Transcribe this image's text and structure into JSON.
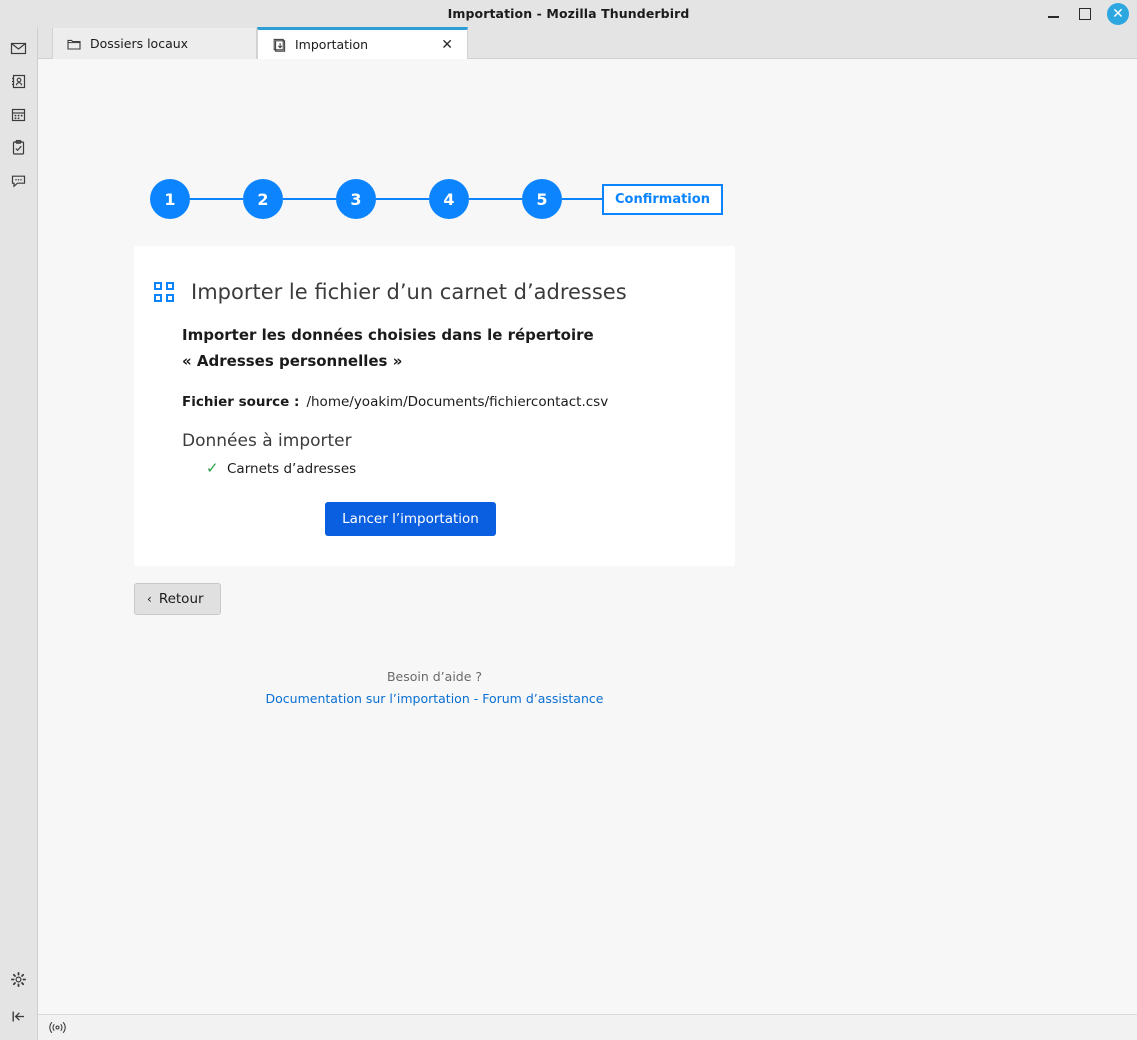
{
  "window": {
    "title": "Importation - Mozilla Thunderbird",
    "controls": {
      "minimize": "minimize-icon",
      "maximize": "maximize-icon",
      "close": "✕"
    }
  },
  "spaces_bar": {
    "items": [
      {
        "name": "mail-icon",
        "label": "Courrier"
      },
      {
        "name": "address-book-icon",
        "label": "Carnet d’adresses"
      },
      {
        "name": "calendar-icon",
        "label": "Agenda"
      },
      {
        "name": "tasks-icon",
        "label": "Tâches"
      },
      {
        "name": "chat-icon",
        "label": "Discussion"
      }
    ],
    "bottom": [
      {
        "name": "settings-gear-icon",
        "label": "Paramètres"
      },
      {
        "name": "collapse-panel-icon",
        "label": "Réduire"
      }
    ]
  },
  "tabs": [
    {
      "label": "Dossiers locaux",
      "icon": "folder-icon",
      "active": false,
      "closable": false
    },
    {
      "label": "Importation",
      "icon": "import-icon",
      "active": true,
      "closable": true,
      "close_glyph": "✕"
    }
  ],
  "progress": {
    "steps": [
      "1",
      "2",
      "3",
      "4",
      "5"
    ],
    "end_label": "Confirmation",
    "accent_color": "#0b84fe"
  },
  "card": {
    "icon": "address-book-grid-icon",
    "title": "Importer le fichier d’un carnet d’adresses",
    "subtitle_line1": "Importer les données choisies dans le répertoire",
    "subtitle_line2": "« Adresses personnelles »",
    "source_label": "Fichier source :",
    "source_path": "/home/yoakim/Documents/fichiercontact.csv",
    "section_title": "Données à importer",
    "items": [
      {
        "check": "✓",
        "label": "Carnets d’adresses"
      }
    ],
    "start_button": "Lancer l’importation",
    "primary_color": "#0a5fe0",
    "check_color": "#2aa14a"
  },
  "back_button": {
    "chevron": "‹",
    "label": "Retour"
  },
  "footer": {
    "help_text": "Besoin d’aide ?",
    "link_doc": "Documentation sur l’importation",
    "separator": "-",
    "link_forum": "Forum d’assistance",
    "link_color": "#0a6fd4"
  },
  "statusbar": {
    "connection_icon": "network-activity-icon"
  }
}
